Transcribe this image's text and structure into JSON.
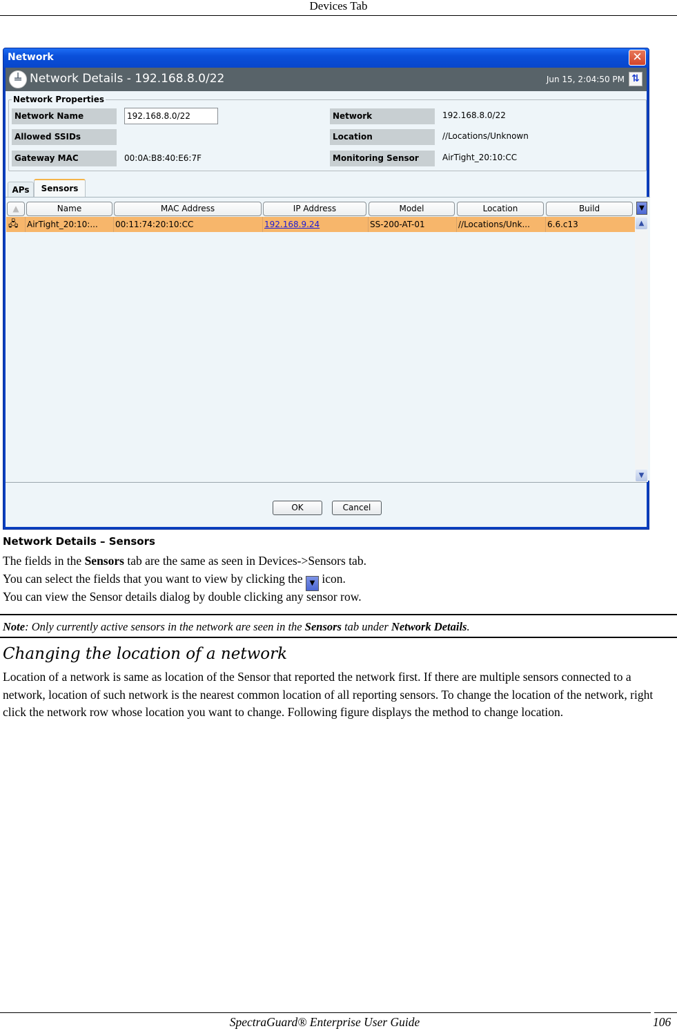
{
  "page_header": "Devices Tab",
  "dialog": {
    "window_title": "Network",
    "close_icon": "close-icon",
    "header_title": "Network Details -  192.168.8.0/22",
    "timestamp": "Jun 15, 2:04:50 PM",
    "refresh_icon": "refresh-icon",
    "properties": {
      "legend": "Network Properties",
      "network_name_label": "Network Name",
      "network_name_value": "192.168.8.0/22",
      "allowed_ssids_label": "Allowed SSIDs",
      "allowed_ssids_value": "",
      "gateway_mac_label": "Gateway MAC",
      "gateway_mac_value": "00:0A:B8:40:E6:7F",
      "network_label": "Network",
      "network_value": "192.168.8.0/22",
      "location_label": "Location",
      "location_value": "//Locations/Unknown",
      "monitoring_sensor_label": "Monitoring Sensor",
      "monitoring_sensor_value": "AirTight_20:10:CC"
    },
    "tabs": [
      {
        "label": "APs",
        "active": false
      },
      {
        "label": "Sensors",
        "active": true
      }
    ],
    "table": {
      "columns": [
        "Name",
        "MAC Address",
        "IP Address",
        "Model",
        "Location",
        "Build"
      ],
      "rows": [
        {
          "name": "AirTight_20:10:...",
          "mac": "00:11:74:20:10:CC",
          "ip": "192.168.9.24",
          "model": "SS-200-AT-01",
          "location": "//Locations/Unk...",
          "build": "6.6.c13",
          "selected": true
        }
      ]
    },
    "ok_label": "OK",
    "cancel_label": "Cancel"
  },
  "caption": "Network Details – Sensors",
  "paragraphs": {
    "p1_pre": "The fields in the ",
    "p1_bold": "Sensors",
    "p1_post": " tab are the same as seen in Devices->Sensors tab.",
    "p2_pre": "You can select the fields that you want to view by clicking the ",
    "p2_post": " icon.",
    "p3": "You can view the Sensor details dialog by double clicking any sensor row."
  },
  "note": {
    "label": "Note",
    "text_pre": ": Only currently active sensors in the network are seen in the ",
    "bold1": "Sensors",
    "text_mid": " tab under ",
    "bold2": "Network Details",
    "text_post": "."
  },
  "section": {
    "title": "Changing the location of a network",
    "body": "Location of a network is same as location of the Sensor that reported the network first. If there are multiple sensors connected to a network, location of such network is the nearest common location of all reporting sensors. To change the location of the network, right click the network row whose location you want to change. Following figure displays the method to change location."
  },
  "footer": {
    "title": "SpectraGuard® Enterprise User Guide",
    "page_number": "106"
  }
}
